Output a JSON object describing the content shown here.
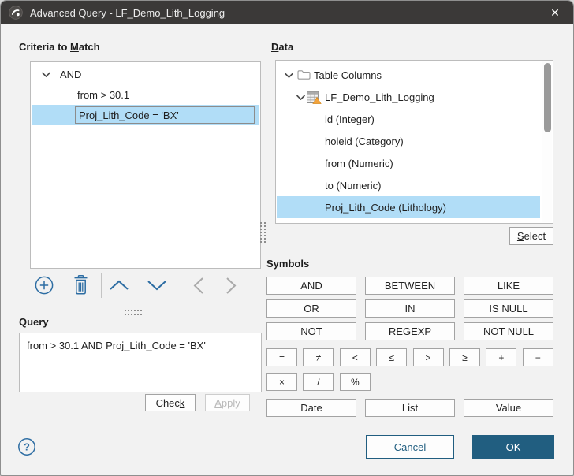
{
  "colors": {
    "titlebar": "#3b3938",
    "accent_blue": "#2d6da3",
    "selection_blue": "#b1ddf7",
    "primary_button": "#215e80",
    "body": "#f2f2f2"
  },
  "window": {
    "title": "Advanced Query - LF_Demo_Lith_Logging",
    "close": "✕"
  },
  "criteria": {
    "label": "Criteria to Match",
    "access_key": "M",
    "tree": [
      {
        "text": "AND"
      },
      {
        "text": "from > 30.1"
      },
      {
        "text": "Proj_Lith_Code = 'BX'"
      }
    ]
  },
  "query": {
    "label": "Query",
    "text": "from > 30.1 AND Proj_Lith_Code = 'BX'",
    "check": "Check",
    "check_key": "k",
    "apply": "Apply",
    "apply_key": "A"
  },
  "data_panel": {
    "label": "Data",
    "access_key": "D",
    "tree": [
      {
        "text": "Table Columns"
      },
      {
        "text": "LF_Demo_Lith_Logging"
      },
      {
        "text": "id (Integer)"
      },
      {
        "text": "holeid (Category)"
      },
      {
        "text": "from (Numeric)"
      },
      {
        "text": "to (Numeric)"
      },
      {
        "text": "Proj_Lith_Code (Lithology)"
      }
    ],
    "select": "Select",
    "select_key": "S"
  },
  "symbols": {
    "label": "Symbols",
    "keywords": [
      "AND",
      "BETWEEN",
      "LIKE",
      "OR",
      "IN",
      "IS NULL",
      "NOT",
      "REGEXP",
      "NOT NULL"
    ],
    "operators_row1": [
      "=",
      "≠",
      "<",
      "≤",
      ">",
      "≥",
      "+",
      "−"
    ],
    "operators_row2": [
      "×",
      "/",
      "%"
    ],
    "value_buttons": [
      "Date",
      "List",
      "Value"
    ]
  },
  "footer": {
    "cancel": "Cancel",
    "cancel_key": "C",
    "ok": "OK",
    "ok_key": "O"
  }
}
